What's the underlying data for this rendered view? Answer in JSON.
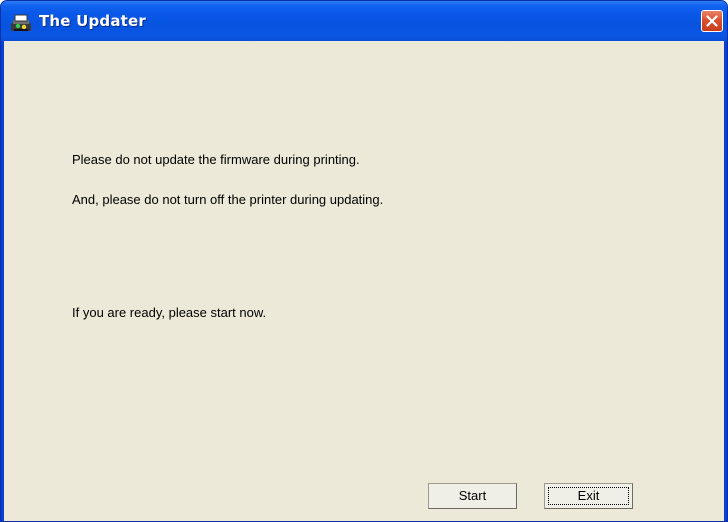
{
  "window": {
    "title": "The Updater",
    "icons": {
      "app": "updater-app-icon",
      "close": "close-icon"
    }
  },
  "content": {
    "line1": "Please do not update the firmware during printing.",
    "line2": "And, please do not turn off the printer during updating.",
    "line3": "If you are ready, please start now."
  },
  "buttons": {
    "start": "Start",
    "exit": "Exit"
  },
  "colors": {
    "titlebar": "#0854e0",
    "client_bg": "#ece9d8",
    "close_button": "#d9512e"
  }
}
